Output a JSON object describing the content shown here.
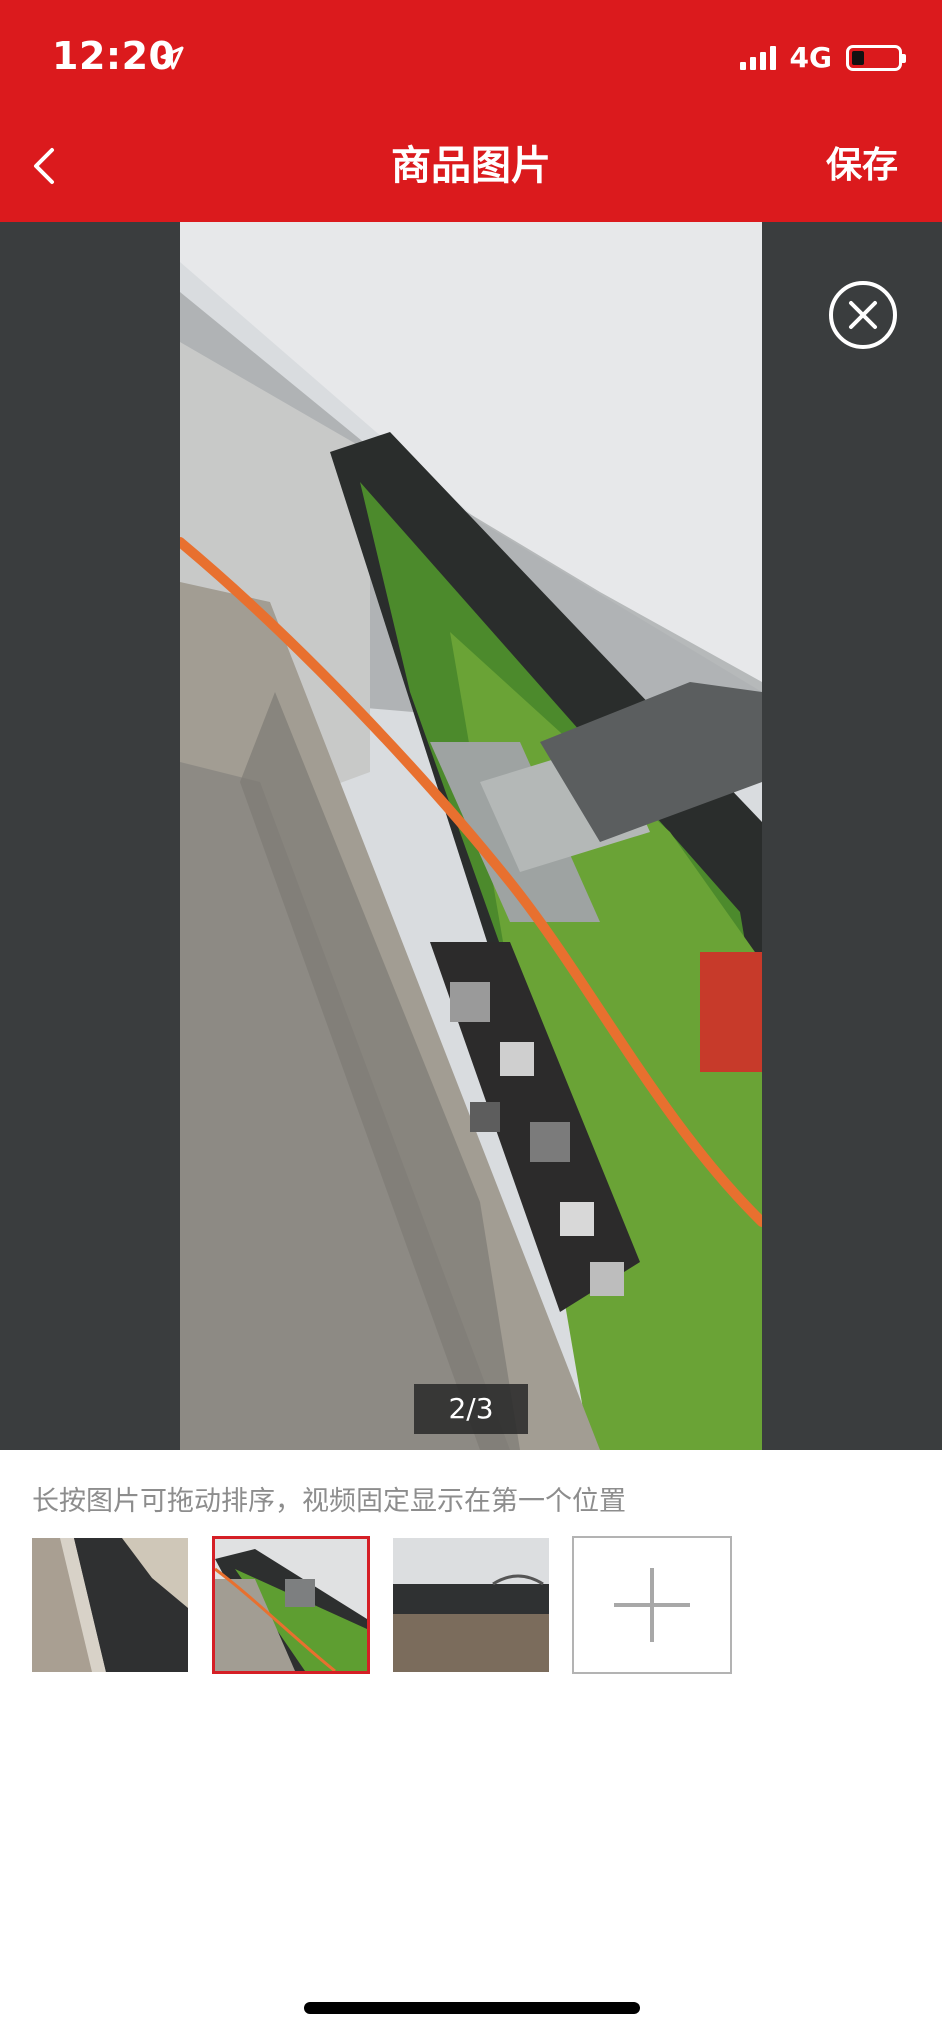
{
  "status_bar": {
    "time": "12:20",
    "location_icon": "location-arrow-icon",
    "network": "4G",
    "battery_icon": "battery-low-icon"
  },
  "nav": {
    "back_icon": "chevron-left-icon",
    "title": "商品图片",
    "save_label": "保存"
  },
  "preview": {
    "close_icon": "close-circle-icon",
    "page_indicator": "2/3"
  },
  "editor": {
    "hint": "长按图片可拖动排序，视频固定显示在第一个位置",
    "add_icon": "plus-icon",
    "selected_index": 1
  },
  "colors": {
    "header_red": "#db1a1d",
    "preview_bg": "#3a3d3e",
    "selected_border": "#d51f26"
  }
}
